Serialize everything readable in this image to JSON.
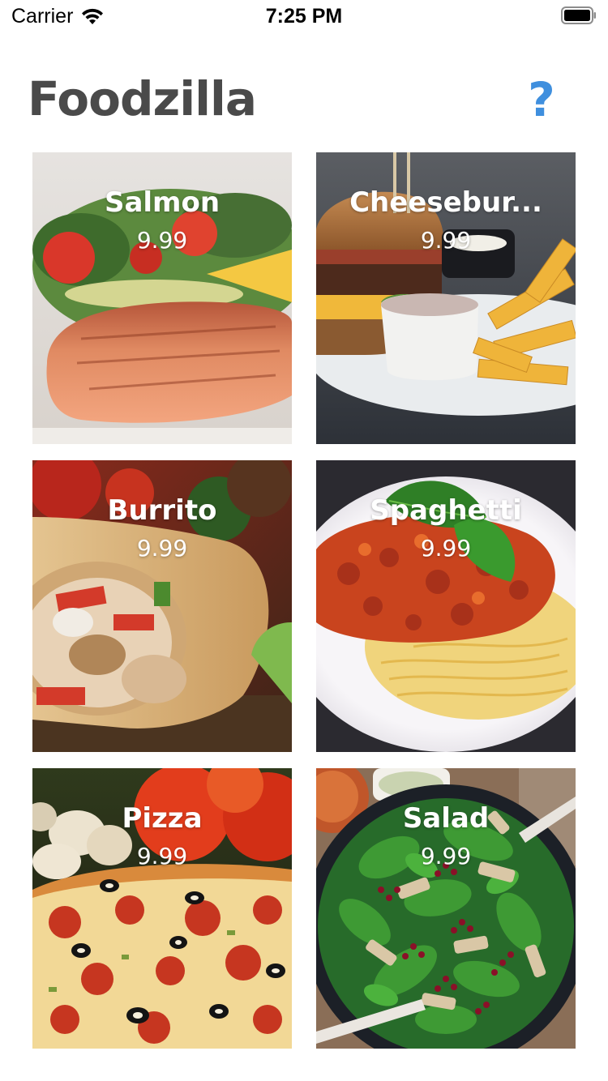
{
  "status_bar": {
    "carrier": "Carrier",
    "time": "7:25 PM"
  },
  "header": {
    "title": "Foodzilla",
    "help_label": "?",
    "help_color": "#3f8fde"
  },
  "items": [
    {
      "name": "Salmon",
      "price": "9.99",
      "image_icon": "salmon-photo"
    },
    {
      "name": "Cheeseburger",
      "display_name": "Cheesebur...",
      "price": "9.99",
      "image_icon": "cheeseburger-photo"
    },
    {
      "name": "Burrito",
      "price": "9.99",
      "image_icon": "burrito-photo"
    },
    {
      "name": "Spaghetti",
      "price": "9.99",
      "image_icon": "spaghetti-photo"
    },
    {
      "name": "Pizza",
      "price": "9.99",
      "image_icon": "pizza-photo"
    },
    {
      "name": "Salad",
      "price": "9.99",
      "image_icon": "salad-photo"
    }
  ]
}
